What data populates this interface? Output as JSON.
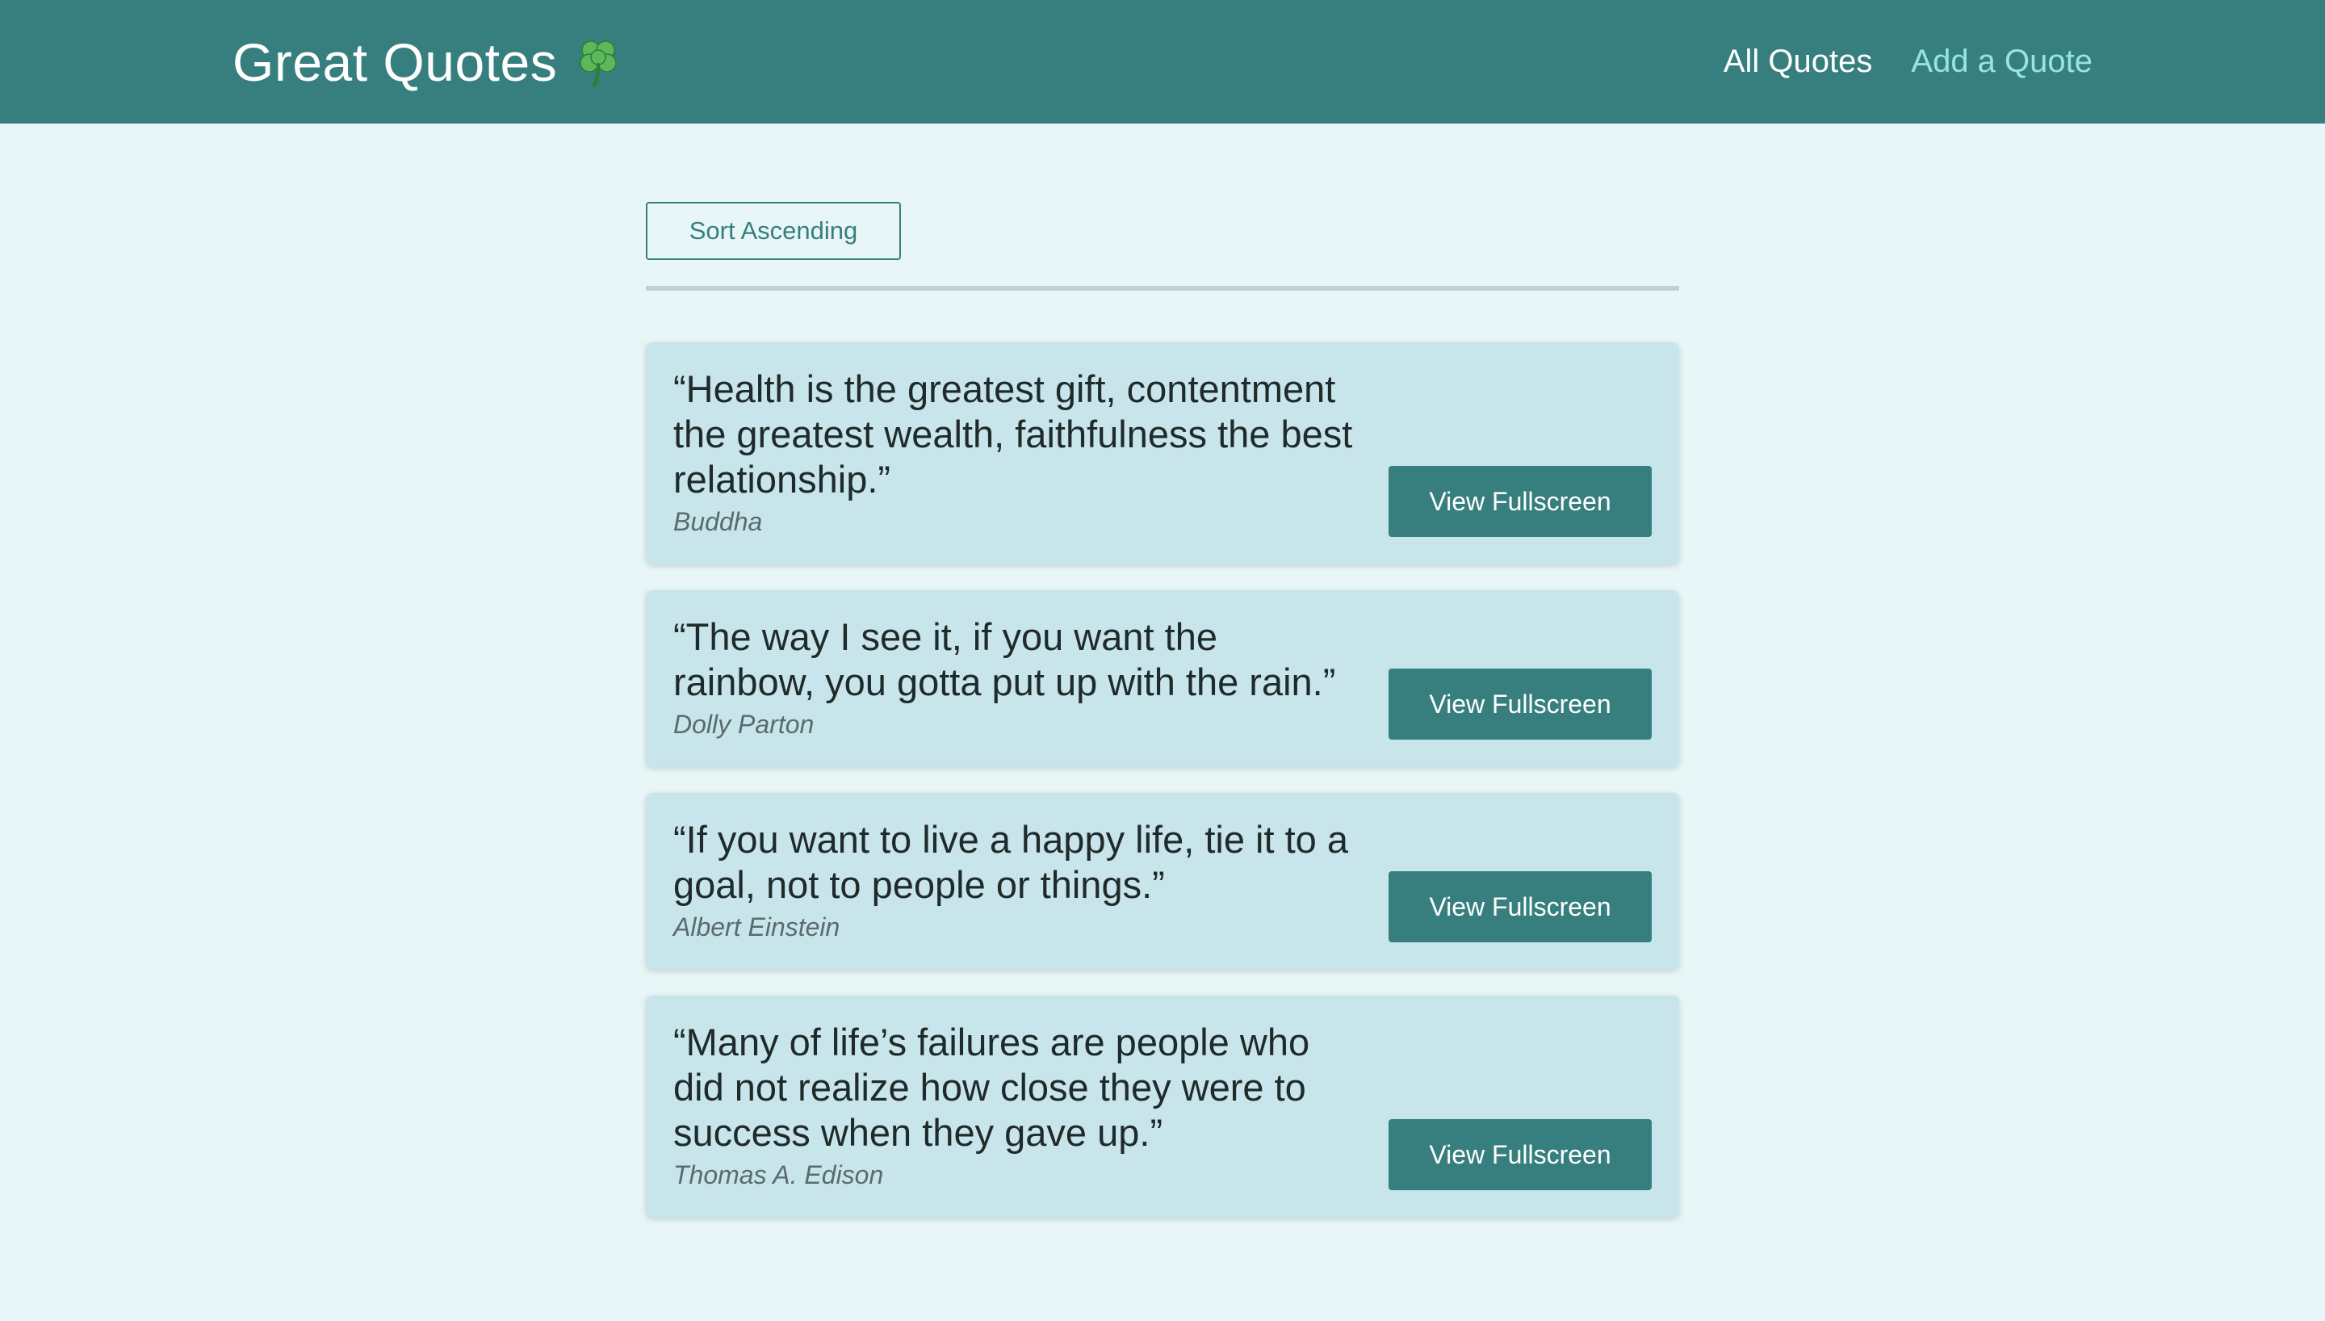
{
  "header": {
    "title": "Great Quotes",
    "logo_icon": "shamrock-icon",
    "nav": [
      {
        "label": "All Quotes",
        "active": true
      },
      {
        "label": "Add a Quote",
        "active": false
      }
    ]
  },
  "main": {
    "sort_label": "Sort Ascending",
    "quotes": [
      {
        "text": "“Health is the greatest gift, contentment the greatest wealth, faithfulness the best relationship.”",
        "author": "Buddha",
        "button_label": "View Fullscreen"
      },
      {
        "text": "“The way I see it, if you want the rainbow, you gotta put up with the rain.”",
        "author": "Dolly Parton",
        "button_label": "View Fullscreen"
      },
      {
        "text": "“If you want to live a happy life, tie it to a goal, not to people or things.”",
        "author": "Albert Einstein",
        "button_label": "View Fullscreen"
      },
      {
        "text": "“Many of life’s failures are people who did not realize how close they were to success when they gave up.”",
        "author": "Thomas A. Edison",
        "button_label": "View Fullscreen"
      }
    ]
  },
  "colors": {
    "header_bg": "#367f7e",
    "page_bg": "#e8f6f7",
    "card_bg": "#c9e5ec",
    "accent": "#367f7e",
    "nav_inactive": "#95e6de"
  }
}
